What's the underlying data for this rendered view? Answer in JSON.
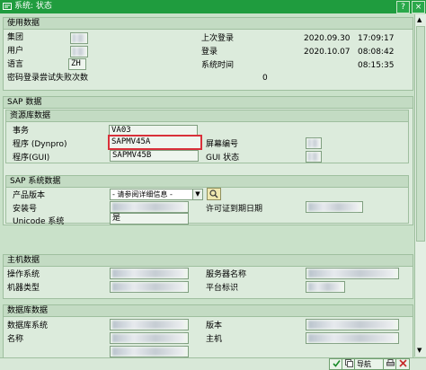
{
  "window": {
    "title": "系统: 状态",
    "btn_help": "?",
    "btn_close": "×"
  },
  "usage": {
    "title": "使用数据",
    "client_label": "集团",
    "user_label": "用户",
    "language_label": "语言",
    "language_value": "ZH",
    "failed_logins_label": "密码登录尝试失败次数",
    "failed_logins_value": "0",
    "last_logon_label": "上次登录",
    "last_logon_date": "2020.09.30",
    "last_logon_time": "17:09:17",
    "logon_label": "登录",
    "logon_date": "2020.10.07",
    "logon_time": "08:08:42",
    "system_time_label": "系统时间",
    "system_time_value": "08:15:35"
  },
  "sap": {
    "title": "SAP 数据",
    "repo": {
      "title": "资源库数据",
      "transaction_label": "事务",
      "transaction_value": "VA03",
      "program_dynpro_label": "程序 (Dynpro)",
      "program_dynpro_value": "SAPMV45A",
      "program_gui_label": "程序(GUI)",
      "program_gui_value": "SAPMV45B",
      "screen_number_label": "屏幕编号",
      "gui_status_label": "GUI 状态"
    },
    "system": {
      "title": "SAP 系统数据",
      "product_version_label": "产品版本",
      "product_version_value": "- 请参阅详细信息 -",
      "install_no_label": "安装号",
      "unicode_label": "Unicode 系统",
      "unicode_value": "是",
      "license_expiry_label": "许可证到期日期"
    }
  },
  "host": {
    "title": "主机数据",
    "os_label": "操作系统",
    "machine_type_label": "机器类型",
    "server_name_label": "服务器名称",
    "platform_id_label": "平台标识"
  },
  "db": {
    "title": "数据库数据",
    "db_system_label": "数据库系统",
    "name_label": "名称",
    "version_label": "版本",
    "host_label": "主机"
  },
  "footer": {
    "nav_label": "导航"
  }
}
